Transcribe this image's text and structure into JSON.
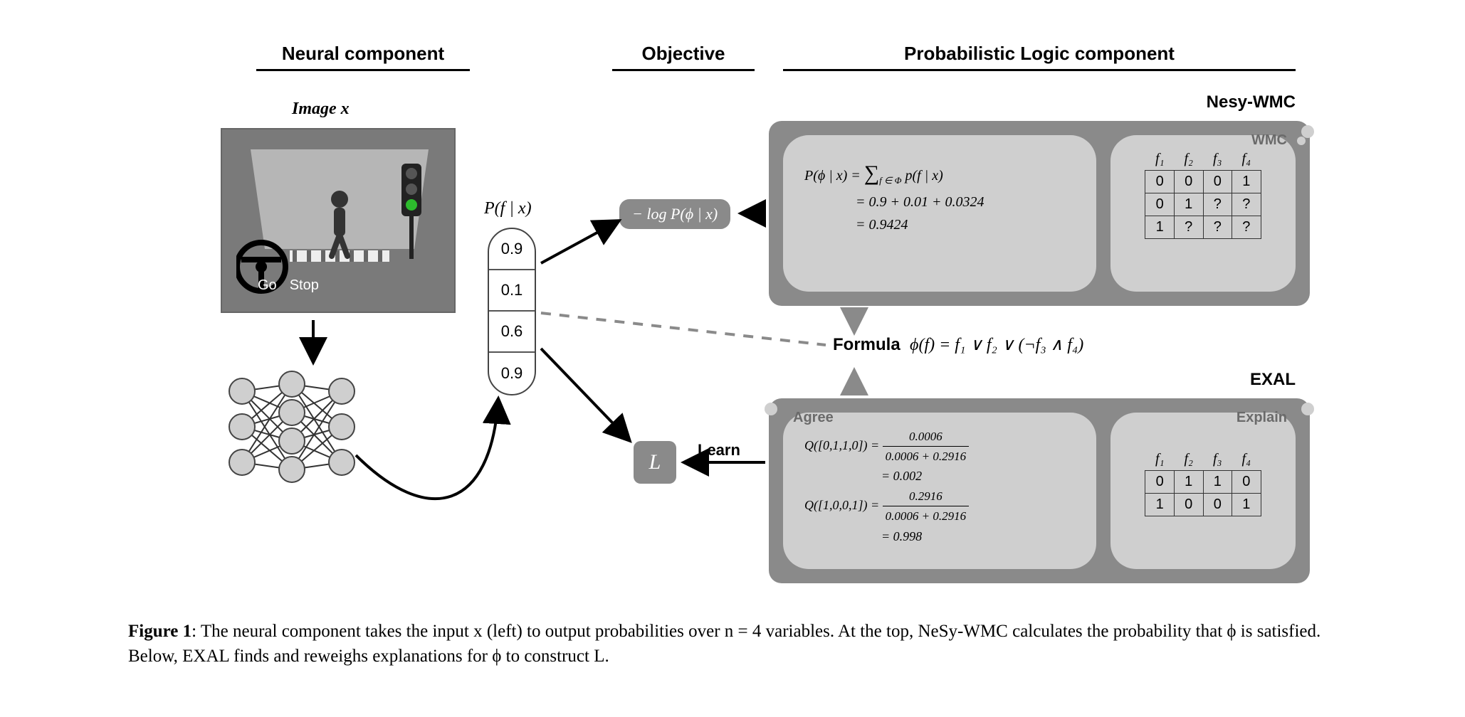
{
  "headers": {
    "neural": "Neural component",
    "objective": "Objective",
    "logic": "Probabilistic Logic component"
  },
  "neural": {
    "image_label": "Image x",
    "go": "Go",
    "stop": "Stop",
    "p_label": "P(f | x)",
    "probs": [
      "0.9",
      "0.1",
      "0.6",
      "0.9"
    ]
  },
  "objective": {
    "obj_box": "− log P(ϕ | x)",
    "learn_label": "Learn",
    "L": "L"
  },
  "logic": {
    "nesy_title": "Nesy-WMC",
    "wmc_label": "WMC",
    "exal_title": "EXAL",
    "agree_label": "Agree",
    "explain_label": "Explain",
    "formula_prefix": "Formula",
    "formula_body": "ϕ(f) = f₁ ∨ f₂ ∨ (¬f₃ ∧ f₄)",
    "nesy_eq": {
      "lhs": "P(ϕ | x) =",
      "sum_sub": "f ∈ Φ",
      "sum_body": "p(f | x)",
      "line2": "= 0.9 + 0.01 + 0.0324",
      "line3": "= 0.9424"
    },
    "nesy_table": {
      "headers": [
        "f₁",
        "f₂",
        "f₃",
        "f₄"
      ],
      "rows": [
        [
          "0",
          "0",
          "0",
          "1"
        ],
        [
          "0",
          "1",
          "?",
          "?"
        ],
        [
          "1",
          "?",
          "?",
          "?"
        ]
      ]
    },
    "exal_eq": {
      "q1_lhs": "Q([0,1,1,0]) =",
      "q1_num": "0.0006",
      "q1_den": "0.0006 + 0.2916",
      "q1_res": "= 0.002",
      "q2_lhs": "Q([1,0,0,1]) =",
      "q2_num": "0.2916",
      "q2_den": "0.0006 + 0.2916",
      "q2_res": "= 0.998"
    },
    "exal_table": {
      "headers": [
        "f₁",
        "f₂",
        "f₃",
        "f₄"
      ],
      "rows": [
        [
          "0",
          "1",
          "1",
          "0"
        ],
        [
          "1",
          "0",
          "0",
          "1"
        ]
      ]
    }
  },
  "caption": {
    "label": "Figure 1",
    "text": ": The neural component takes the input x (left) to output probabilities over n = 4 variables. At the top, NeSy-WMC calculates the probability that ϕ is satisfied. Below, EXAL finds and reweighs explanations for ϕ to construct L."
  }
}
